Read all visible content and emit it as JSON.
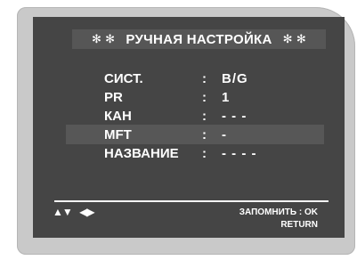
{
  "menu": {
    "title": "РУЧНАЯ НАСТРОЙКА",
    "title_symbol": "✻",
    "rows": [
      {
        "label": "СИСТ.",
        "separator": ":",
        "value": "B/G",
        "selected": false
      },
      {
        "label": "PR",
        "separator": ":",
        "value": "1",
        "selected": false
      },
      {
        "label": "КАН",
        "separator": ":",
        "value": "- - -",
        "selected": false
      },
      {
        "label": "MFT",
        "separator": ":",
        "value": "-",
        "selected": true
      },
      {
        "label": "НАЗВАНИЕ",
        "separator": ":",
        "value": "- - - -",
        "selected": false
      }
    ]
  },
  "footer": {
    "up_down_glyph": "▲▼",
    "left_right_glyph": "◀▶",
    "save_hint": "ЗАПОМНИТЬ : OK",
    "return_hint": "RETURN"
  },
  "colors": {
    "screen_background": "#454545",
    "highlight": "#575757",
    "bezel": "#c9c9c9",
    "text": "#ffffff"
  }
}
